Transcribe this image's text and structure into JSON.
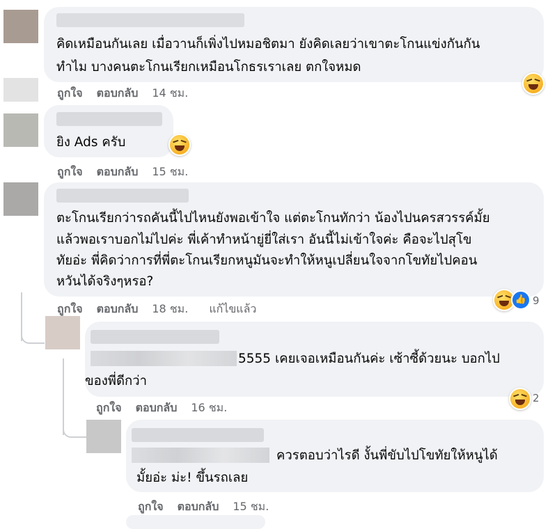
{
  "comments": [
    {
      "text_lines": [
        "คิดเหมือนกันเลย เมื่อวานก็เพิ่งไปหมอชิตมา ยังคิดเลยว่าเขาตะโกนแข่งกันกัน",
        "ทำไม บางคนตะโกนเรียกเหมือนโกธรเราเลย ตกใจหมด"
      ],
      "like": "ถูกใจ",
      "reply": "ตอบกลับ",
      "time": "14 ชม."
    },
    {
      "text_lines": [
        "ยิง Ads ครับ"
      ],
      "like": "ถูกใจ",
      "reply": "ตอบกลับ",
      "time": "15 ชม."
    },
    {
      "text_lines": [
        "ตะโกนเรียกว่ารถคันนี้ไปไหนยังพอเข้าใจ แต่ตะโกนทักว่า น้องไปนครสวรรค์มั้ย",
        "แล้วพอเราบอกไม่ไปค่ะ พี่เค้าทำหน้ายู่ยี่ใส่เรา อันนี้ไม่เข้าใจค่ะ คือจะไปสุโข",
        "ทัยอ่ะ พี่คิดว่าการที่พี่ตะโกนเรียกหนูมันจะทำให้หนูเปลี่ยนใจจากโขทัยไปคอน",
        "หวันได้จริงๆหรอ?"
      ],
      "like": "ถูกใจ",
      "reply": "ตอบกลับ",
      "time": "18 ชม.",
      "edited": "แก้ไขแล้ว",
      "reaction_count": "9"
    },
    {
      "text_lines": [
        "5555 เคยเจอเหมือนกันค่ะ เซ้าซี้ด้วยนะ บอกไป",
        "ของพี่ดีกว่า"
      ],
      "like": "ถูกใจ",
      "reply": "ตอบกลับ",
      "time": "16 ชม.",
      "reaction_count": "2"
    },
    {
      "text_lines": [
        "ควรตอบว่าไรดี งั้นพี่ขับไปโขทัยให้หนูได้",
        "มั้ยอ่ะ ม่ะ! ขึ้นรถเลย"
      ],
      "like": "ถูกใจ",
      "reply": "ตอบกลับ",
      "time": "15 ชม."
    }
  ]
}
